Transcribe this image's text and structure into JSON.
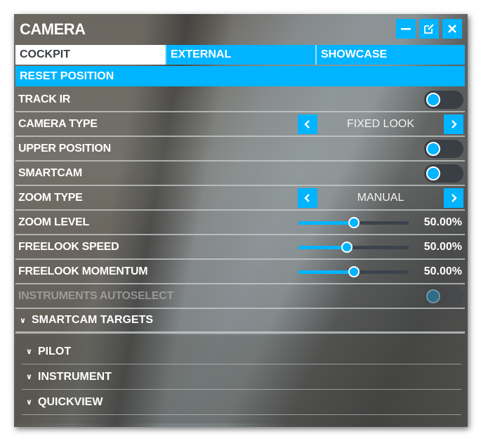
{
  "window": {
    "title": "CAMERA",
    "buttons": {
      "minimize": "minimize",
      "popout": "pop-out",
      "close": "close"
    }
  },
  "tabs": [
    {
      "label": "COCKPIT",
      "active": true
    },
    {
      "label": "EXTERNAL",
      "active": false
    },
    {
      "label": "SHOWCASE",
      "active": false
    }
  ],
  "reset_label": "RESET POSITION",
  "settings": {
    "track_ir": {
      "label": "TRACK IR",
      "value": false
    },
    "camera_type": {
      "label": "CAMERA TYPE",
      "value": "FIXED LOOK"
    },
    "upper_position": {
      "label": "UPPER POSITION",
      "value": false
    },
    "smartcam": {
      "label": "SMARTCAM",
      "value": false
    },
    "zoom_type": {
      "label": "ZOOM TYPE",
      "value": "MANUAL"
    },
    "zoom_level": {
      "label": "ZOOM LEVEL",
      "value_text": "50.00%",
      "value": 0.5
    },
    "freelook_speed": {
      "label": "FREELOOK SPEED",
      "value_text": "50.00%",
      "value": 0.44
    },
    "freelook_momentum": {
      "label": "FREELOOK MOMENTUM",
      "value_text": "50.00%",
      "value": 0.5
    },
    "instruments_autoselect": {
      "label": "INSTRUMENTS AUTOSELECT",
      "value": false,
      "disabled": true
    }
  },
  "smartcam_targets": {
    "label": "SMARTCAM TARGETS",
    "items": [
      {
        "label": "PILOT"
      },
      {
        "label": "INSTRUMENT"
      },
      {
        "label": "QUICKVIEW"
      }
    ]
  },
  "colors": {
    "accent": "#00b4ff",
    "track": "#3c434c",
    "active_tab_bg": "#ffffff",
    "active_tab_text": "#3b4047"
  }
}
